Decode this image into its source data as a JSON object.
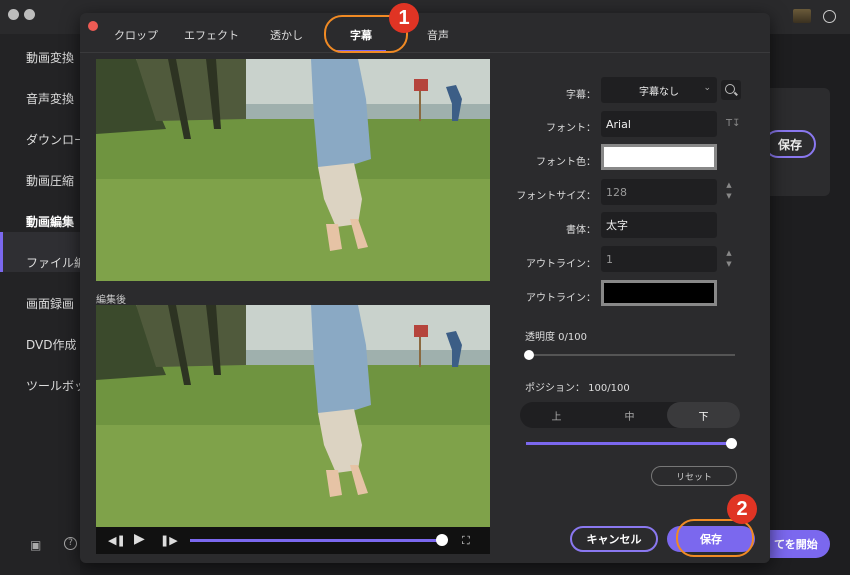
{
  "sidebar": {
    "items": [
      {
        "label": "動画変換"
      },
      {
        "label": "音声変換"
      },
      {
        "label": "ダウンロー"
      },
      {
        "label": "動画圧縮"
      },
      {
        "label": "動画編集"
      },
      {
        "label": "ファイル編"
      },
      {
        "label": "画面録画"
      },
      {
        "label": "DVD作成"
      },
      {
        "label": "ツールボッ"
      }
    ],
    "active_index": 4
  },
  "background": {
    "save_label": "保存",
    "start_label": "てを開始"
  },
  "dialog": {
    "tabs": [
      {
        "label": "クロップ"
      },
      {
        "label": "エフェクト"
      },
      {
        "label": "透かし"
      },
      {
        "label": "字幕"
      },
      {
        "label": "音声"
      }
    ],
    "active_tab": "字幕",
    "preview_after_label": "編集後",
    "player": {
      "progress_fraction": 0.98
    },
    "subtitle": {
      "label": "字幕：",
      "value": "字幕なし"
    },
    "font": {
      "label": "フォント：",
      "value": "Arial"
    },
    "font_color": {
      "label": "フォント色：",
      "color": "#ffffff"
    },
    "font_size": {
      "label": "フォントサイズ：",
      "value": "128"
    },
    "font_style": {
      "label": "書体：",
      "value": "太字"
    },
    "outline_width": {
      "label": "アウトライン：",
      "value": "1"
    },
    "outline_color": {
      "label": "アウトライン：",
      "color": "#000000"
    },
    "opacity": {
      "label": "透明度 0/100",
      "value": 0
    },
    "position": {
      "label": "ポジション： 100/100",
      "options": [
        "上",
        "中",
        "下"
      ],
      "selected": "下",
      "value": 100
    },
    "reset_label": "リセット",
    "cancel_label": "キャンセル",
    "save_label": "保存"
  },
  "annotations": [
    {
      "number": "1"
    },
    {
      "number": "2"
    }
  ],
  "colors": {
    "accent": "#7b68ee",
    "annotation_orange": "#f08a24",
    "annotation_red": "#e03424"
  }
}
